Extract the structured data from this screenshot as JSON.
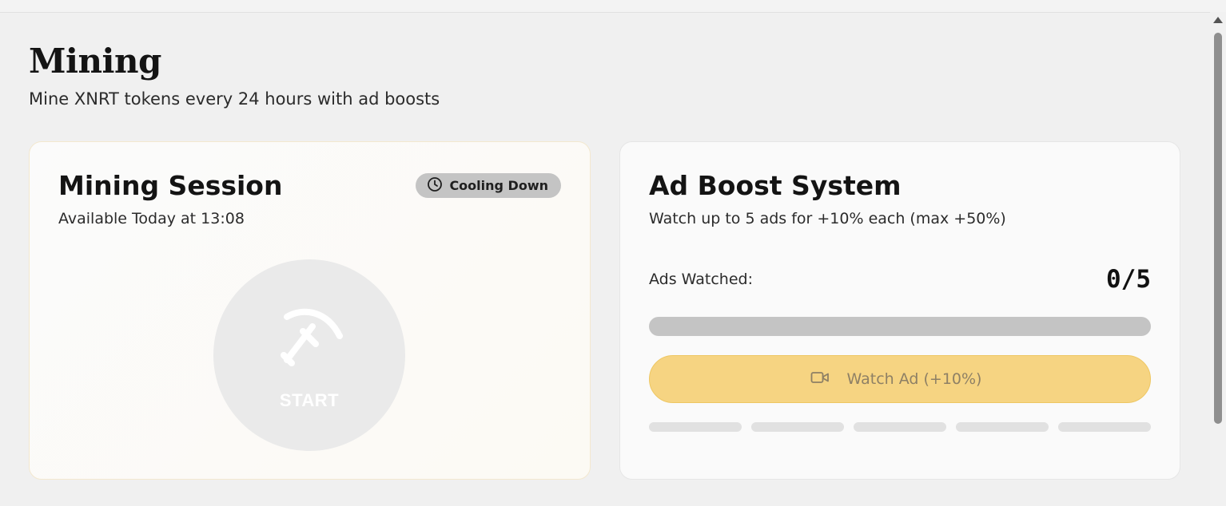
{
  "page": {
    "title": "Mining",
    "subtitle": "Mine XNRT tokens every 24 hours with ad boosts"
  },
  "mining_card": {
    "title": "Mining Session",
    "subtitle": "Available Today at 13:08",
    "status_badge": "Cooling Down",
    "status_icon": "clock-icon",
    "start_label": "START",
    "start_icon": "pickaxe-icon"
  },
  "ad_card": {
    "title": "Ad Boost System",
    "subtitle": "Watch up to 5 ads for +10% each (max +50%)",
    "ads_label": "Ads Watched:",
    "ads_count": "0/5",
    "ads_watched": 0,
    "ads_max": 5,
    "watch_button_label": "Watch Ad (+10%)",
    "watch_button_icon": "video-camera-icon"
  },
  "colors": {
    "background": "#f0f0f0",
    "accent": "#f6d482",
    "badge": "#c4c4c4"
  }
}
